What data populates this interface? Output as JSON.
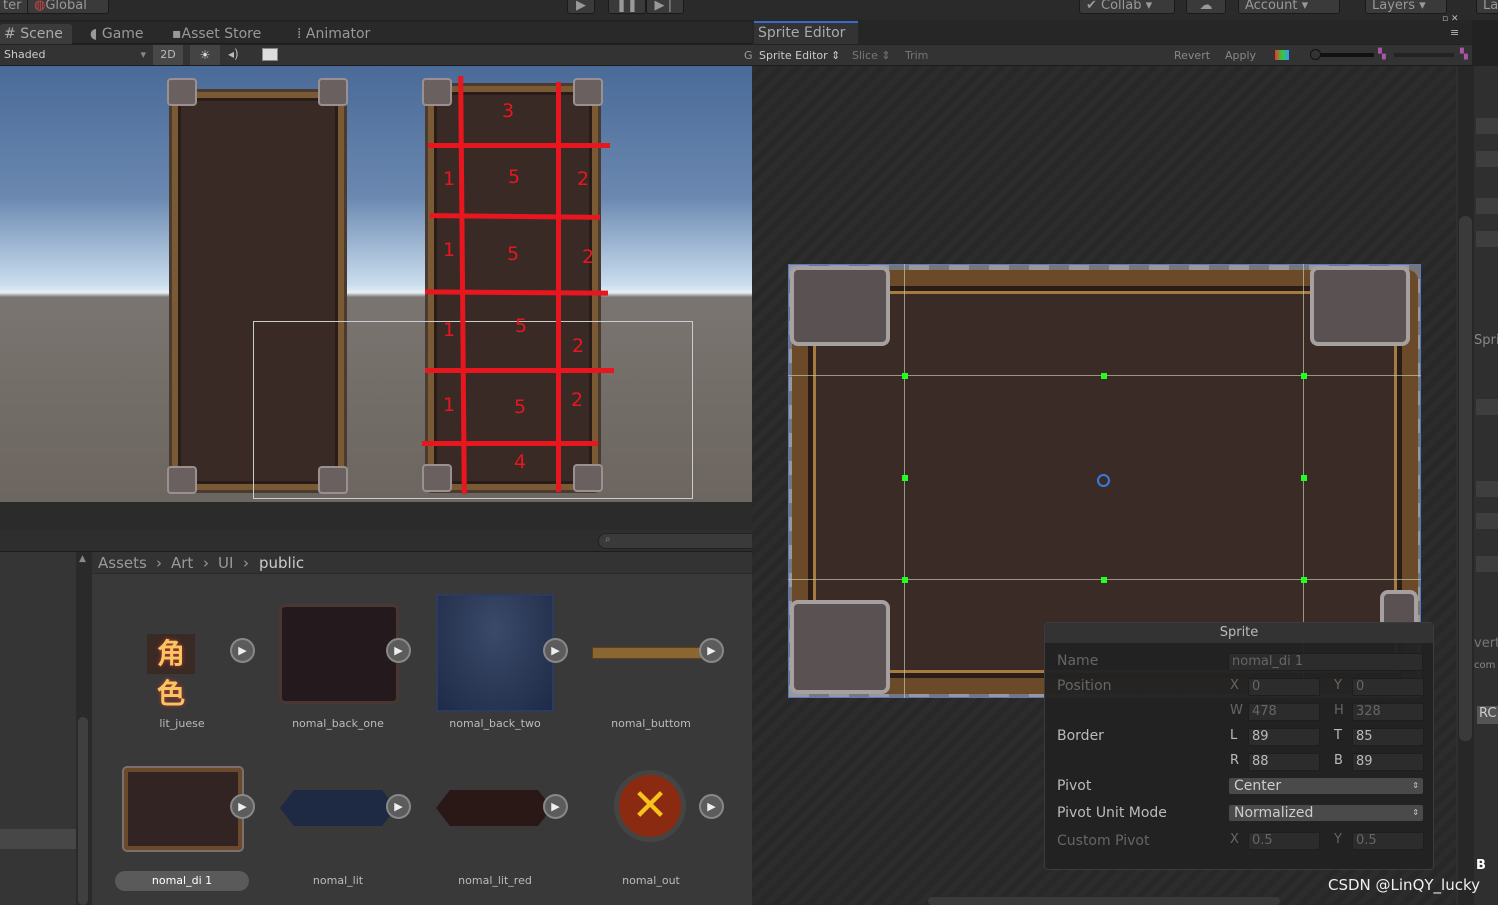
{
  "topbar": {
    "left_partial": "ter",
    "global": "Global",
    "collab": "Collab",
    "account": "Account",
    "layers": "Layers",
    "layout_partial": "La"
  },
  "scene_tabs": [
    {
      "label": "Scene"
    },
    {
      "label": "Game"
    },
    {
      "label": "Asset Store"
    },
    {
      "label": "Animator"
    }
  ],
  "scene_toolbar": {
    "shading": "Shaded",
    "mode_2d": "2D"
  },
  "scene": {
    "annotations": {
      "top": "3",
      "left": "1",
      "center": "5",
      "right": "2",
      "bottom": "4"
    }
  },
  "project": {
    "breadcrumb": [
      "Assets",
      "Art",
      "UI",
      "public"
    ],
    "assets": [
      {
        "name": "lit_juese",
        "thumb_text": "角色"
      },
      {
        "name": "nomal_back_one"
      },
      {
        "name": "nomal_back_two"
      },
      {
        "name": "nomal_buttom"
      },
      {
        "name": "nomal_di 1",
        "selected": true
      },
      {
        "name": "nomal_lit"
      },
      {
        "name": "nomal_lit_red"
      },
      {
        "name": "nomal_out"
      }
    ]
  },
  "sprite_editor": {
    "tab": "Sprite Editor",
    "mode": "Sprite Editor",
    "slice": "Slice",
    "trim": "Trim",
    "revert": "Revert",
    "apply": "Apply",
    "partial_g": "G"
  },
  "sprite_panel": {
    "title": "Sprite",
    "name_label": "Name",
    "name_value": "nomal_di 1",
    "position_label": "Position",
    "x": "0",
    "y": "0",
    "w": "478",
    "h": "328",
    "border_label": "Border",
    "l": "89",
    "t": "85",
    "r": "88",
    "b": "89",
    "pivot_label": "Pivot",
    "pivot_value": "Center",
    "pivot_unit_label": "Pivot Unit Mode",
    "pivot_unit_value": "Normalized",
    "custom_pivot_label": "Custom Pivot",
    "custom_x": "0.5",
    "custom_y": "0.5",
    "axis": {
      "x": "X",
      "y": "Y",
      "w": "W",
      "h": "H",
      "l": "L",
      "t": "T",
      "r": "R",
      "b": "B"
    }
  },
  "inspector_partial": {
    "spri": "Spri",
    "vert": "vert",
    "com": "com",
    "rc": "RC",
    "b": "B"
  },
  "watermark": "CSDN @LinQY_lucky"
}
